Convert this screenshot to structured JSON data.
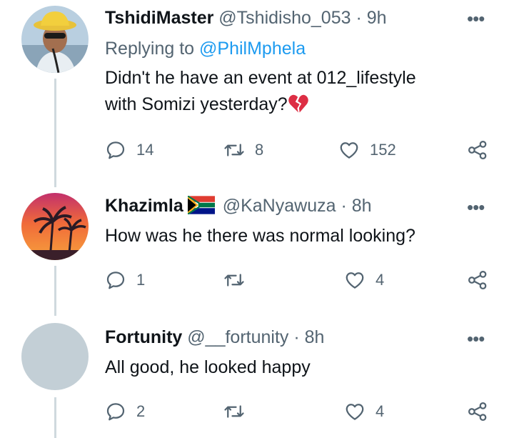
{
  "tweets": [
    {
      "name": "TshidiMaster",
      "handle": "@Tshidisho_053",
      "time": "9h",
      "separator": "·",
      "replying_prefix": "Replying to ",
      "replying_to": "@PhilMphela",
      "text_line1": "Didn't he have an event at 012_lifestyle",
      "text_line2": "with Somizi yesterday?",
      "emoji": "broken-heart",
      "replies": "14",
      "retweets": "8",
      "likes": "152"
    },
    {
      "name": "Khazimla",
      "flag": "south-africa-flag",
      "handle": "@KaNyawuza",
      "time": "8h",
      "separator": "·",
      "text_line1": "How was he there was normal looking?",
      "replies": "1",
      "retweets": "",
      "likes": "4"
    },
    {
      "name": "Fortunity",
      "handle": "@__fortunity",
      "time": "8h",
      "separator": "·",
      "text_line1": "All good, he looked happy",
      "replies": "2",
      "retweets": "",
      "likes": "4"
    }
  ],
  "more_label": "•••",
  "colors": {
    "text": "#0f1419",
    "secondary": "#536471",
    "link": "#1d9bf0",
    "thread": "#cfd9de"
  }
}
